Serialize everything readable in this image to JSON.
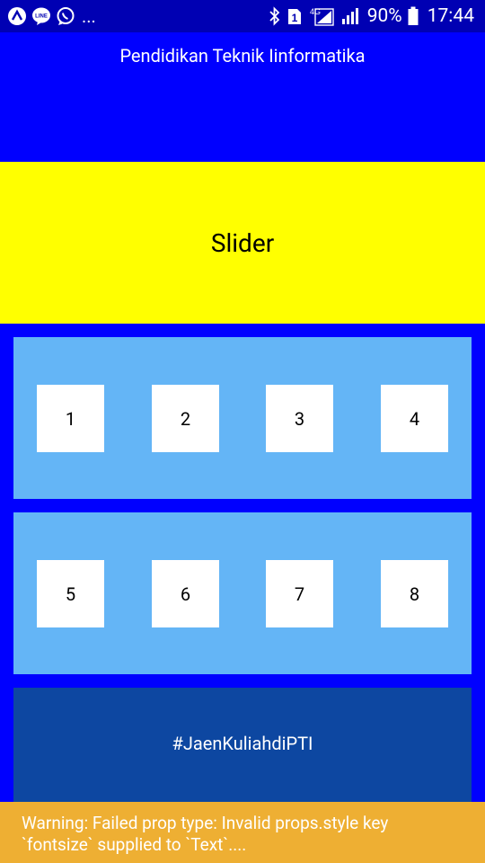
{
  "status_bar": {
    "left_icons": [
      "arrow-up-circle-icon",
      "line-app-icon",
      "whatsapp-icon"
    ],
    "overflow": "...",
    "right_icons": [
      "bluetooth-icon",
      "sim-1-icon",
      "4g-signal-icon",
      "signal-icon",
      "battery-icon"
    ],
    "network_label": "4G",
    "sim_label": "1",
    "battery_percent": "90%",
    "time": "17:44"
  },
  "header": {
    "title": "Pendidikan Teknik Iinformatika"
  },
  "slider": {
    "label": "Slider"
  },
  "menu": {
    "row1": [
      "1",
      "2",
      "3",
      "4"
    ],
    "row2": [
      "5",
      "6",
      "7",
      "8"
    ]
  },
  "footer": {
    "hashtag": "#JaenKuliahdiPTI"
  },
  "warning": {
    "line1": "Warning: Failed prop type: Invalid props.style key",
    "line2": "`fontsize` supplied to `Text`...."
  },
  "colors": {
    "status_bar": "#0000b3",
    "background": "#0000ff",
    "slider": "#ffff00",
    "menu_row": "#64b5f6",
    "tile": "#ffffff",
    "hashtag_bg": "#0d47a1",
    "warning_bg": "#eeaf33"
  }
}
